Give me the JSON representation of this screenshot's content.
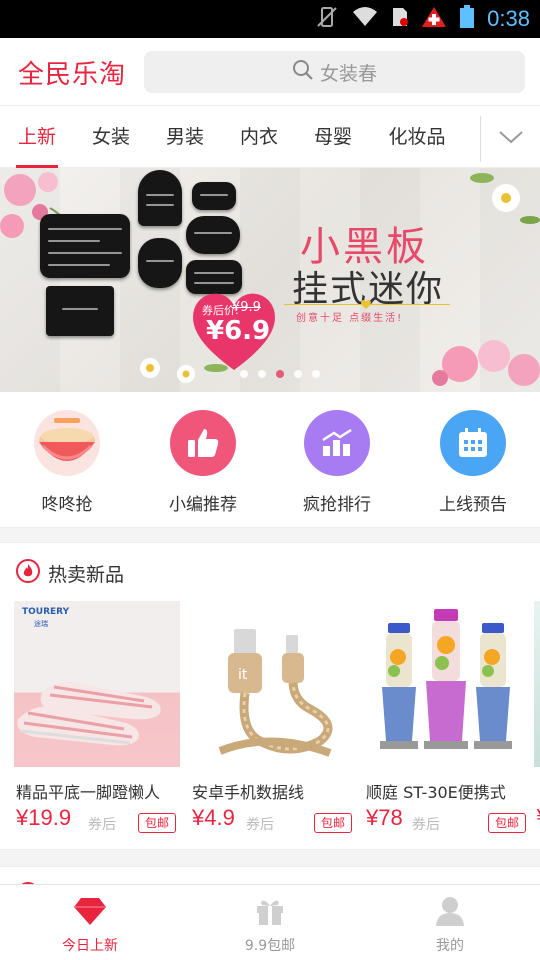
{
  "status_bar": {
    "time": "0:38"
  },
  "header": {
    "brand": "全民乐淘",
    "search_placeholder": "女装春"
  },
  "tabs": [
    {
      "label": "上新",
      "active": true
    },
    {
      "label": "女装"
    },
    {
      "label": "男装"
    },
    {
      "label": "内衣"
    },
    {
      "label": "母婴"
    },
    {
      "label": "化妆品"
    }
  ],
  "banner": {
    "title_line1": "小黑板",
    "title_line2": "挂式迷你",
    "slogan": "创意十足   点缀生活!",
    "coupon_label": "券后价:",
    "original_price": "¥9.9",
    "coupon_price": "¥6.9",
    "board_texts": [
      "Drinks",
      "Caféna",
      "Latte",
      "黑板故事"
    ],
    "carousel_total": 5,
    "carousel_active": 2
  },
  "quick_entries": [
    {
      "label": "咚咚抢",
      "icon": "bowl-icon",
      "color": "#f6a6a0"
    },
    {
      "label": "小编推荐",
      "icon": "thumbs-up-icon",
      "color": "#f0567a"
    },
    {
      "label": "疯抢排行",
      "icon": "bar-chart-icon",
      "color": "#a77cf2"
    },
    {
      "label": "上线预告",
      "icon": "calendar-icon",
      "color": "#4aa6f5"
    }
  ],
  "hot_section": {
    "title": "热卖新品",
    "products": [
      {
        "name": "精品平底一脚蹬懒人",
        "price": "¥19.9",
        "after": "券后",
        "tag": "包邮",
        "brand_text": "TOURERY",
        "brand_sub": "途瑞"
      },
      {
        "name": "安卓手机数据线",
        "price": "¥4.9",
        "after": "券后",
        "tag": "包邮"
      },
      {
        "name": "顺庭 ST-30E便携式",
        "price": "¥78",
        "after": "券后",
        "tag": "包邮"
      }
    ],
    "peek_price": "¥"
  },
  "bottom_nav": [
    {
      "label": "今日上新",
      "icon": "diamond-icon",
      "active": true
    },
    {
      "label": "9.9包邮",
      "icon": "gift-icon"
    },
    {
      "label": "我的",
      "icon": "user-icon"
    }
  ],
  "colors": {
    "accent": "#e8243f",
    "inactive": "#999999"
  }
}
